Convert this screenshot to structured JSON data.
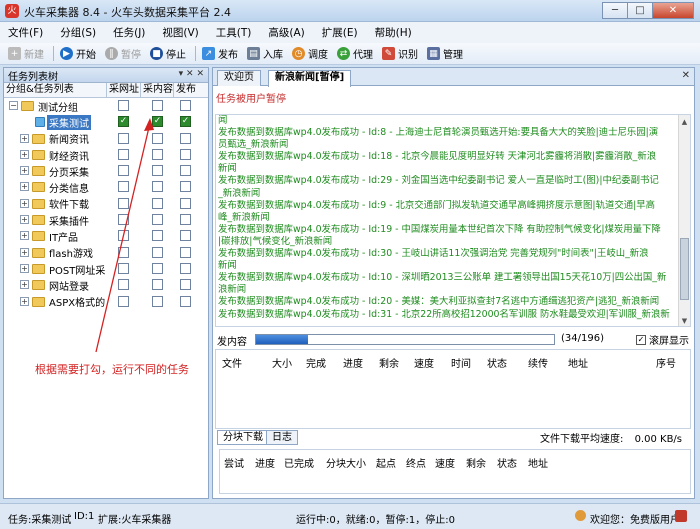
{
  "window": {
    "title": "火车采集器 8.4 - 火车头数据采集平台 2.4",
    "controls": {
      "minimize": "─",
      "maximize": "□",
      "close": "✕"
    }
  },
  "menu": [
    "文件(F)",
    "分组(S)",
    "任务(J)",
    "视图(V)",
    "工具(T)",
    "高级(A)",
    "扩展(E)",
    "帮助(H)"
  ],
  "toolbar": {
    "new": "新建",
    "start": "开始",
    "pause": "暂停",
    "stop": "停止",
    "publish": "发布",
    "import": "入库",
    "dispatch": "调度",
    "proxy": "代理",
    "captcha": "识别",
    "manage": "管理"
  },
  "left_panel": {
    "title": "任务列表树",
    "head_controls": "▾ ✕ ✕",
    "columns": [
      "分组&任务列表",
      "采网址",
      "采内容",
      "发布"
    ],
    "tree": [
      {
        "label": "测试分组",
        "expander": "−",
        "level": 0,
        "checks": [
          false,
          false,
          false
        ],
        "selected": false
      },
      {
        "label": "采集测试",
        "expander": "",
        "level": 2,
        "checks": [
          true,
          true,
          true
        ],
        "selected": true
      },
      {
        "label": "新闻资讯",
        "expander": "+",
        "level": 1,
        "checks": [
          false,
          false,
          false
        ],
        "selected": false
      },
      {
        "label": "财经资讯",
        "expander": "+",
        "level": 1,
        "checks": [
          false,
          false,
          false
        ],
        "selected": false
      },
      {
        "label": "分页采集",
        "expander": "+",
        "level": 1,
        "checks": [
          false,
          false,
          false
        ],
        "selected": false
      },
      {
        "label": "分类信息",
        "expander": "+",
        "level": 1,
        "checks": [
          false,
          false,
          false
        ],
        "selected": false
      },
      {
        "label": "软件下载",
        "expander": "+",
        "level": 1,
        "checks": [
          false,
          false,
          false
        ],
        "selected": false
      },
      {
        "label": "采集插件",
        "expander": "+",
        "level": 1,
        "checks": [
          false,
          false,
          false
        ],
        "selected": false
      },
      {
        "label": "IT产品",
        "expander": "+",
        "level": 1,
        "checks": [
          false,
          false,
          false
        ],
        "selected": false
      },
      {
        "label": "flash游戏",
        "expander": "+",
        "level": 1,
        "checks": [
          false,
          false,
          false
        ],
        "selected": false
      },
      {
        "label": "POST网址采",
        "expander": "+",
        "level": 1,
        "checks": [
          false,
          false,
          false
        ],
        "selected": false
      },
      {
        "label": "网站登录",
        "expander": "+",
        "level": 1,
        "checks": [
          false,
          false,
          false
        ],
        "selected": false
      },
      {
        "label": "ASPX格式的",
        "expander": "+",
        "level": 1,
        "checks": [
          false,
          false,
          false
        ],
        "selected": false
      }
    ]
  },
  "annotation": "根据需要打勾，运行不同的任务",
  "tabs": [
    {
      "label": "欢迎页",
      "active": false
    },
    {
      "label": "新浪新闻[暂停]",
      "active": true
    }
  ],
  "tab_close": "✕",
  "task_status": "任务被用户暂停",
  "log_lines": [
    "闻",
    "发布数据到数据库wp4.0发布成功  - Id:8 - 上海迪士尼首轮演员甄选开始:要具备大大的笑脸|迪士尼乐园|演",
    "员甄选_新浪新闻",
    "发布数据到数据库wp4.0发布成功  - Id:18 - 北京今晨能见度明显好转 天津河北雾霾将消散|雾霾消散_新浪",
    "新闻",
    "发布数据到数据库wp4.0发布成功  - Id:29 - 刘金国当选中纪委副书记 爱人一直是临时工(图)|中纪委副书记",
    "_新浪新闻",
    "发布数据到数据库wp4.0发布成功  - Id:9 - 北京交通部门拟发轨道交通早高峰拥挤度示意图|轨道交通|早高",
    "峰_新浪新闻",
    "发布数据到数据库wp4.0发布成功  - Id:19 - 中国煤炭用量本世纪首次下降 有助控制气候变化|煤炭用量下降",
    "|碳排放|气候变化_新浪新闻",
    "发布数据到数据库wp4.0发布成功  - Id:30 - 王岐山讲话11次强调治党 完善党规列\"时间表\"|王岐山_新浪",
    "新闻",
    "发布数据到数据库wp4.0发布成功  - Id:10 - 深圳晒2013三公账单 建工署领导出国15天花10万|四公出国_新",
    "浪新闻",
    "发布数据到数据库wp4.0发布成功  - Id:20 - 美媒：美大利亚拟查封7名逃中方通缉逃犯资产|逃犯_新浪新闻",
    "发布数据到数据库wp4.0发布成功  - Id:31 - 北京22所高校招12000名军训服 防水鞋最受欢迎|军训服_新浪新"
  ],
  "progress": {
    "label": "发内容",
    "fraction": 0.173,
    "count_text": "(34/196)",
    "autoscroll_label": "滚屏显示",
    "autoscroll_checked": true
  },
  "file_table_headers": [
    "文件",
    "大小",
    "完成",
    "进度",
    "剩余",
    "速度",
    "时间",
    "状态",
    "续传",
    "地址",
    "序号"
  ],
  "bottom_tabs": [
    {
      "label": "分块下载",
      "active": true
    },
    {
      "label": "日志",
      "active": false
    }
  ],
  "speed": {
    "label": "文件下载平均速度:",
    "value": "0.00 KB/s"
  },
  "download_headers": [
    "尝试",
    "进度",
    "已完成",
    "分块大小",
    "起点",
    "终点",
    "速度",
    "剩余",
    "状态",
    "地址"
  ],
  "statusbar": {
    "task": "任务:采集测试",
    "id": "ID:1",
    "extension": "扩展:火车采集器",
    "run_state": "运行中:0，就绪:0，暂停:1，停止:0",
    "welcome": "欢迎您：免费版用户"
  }
}
